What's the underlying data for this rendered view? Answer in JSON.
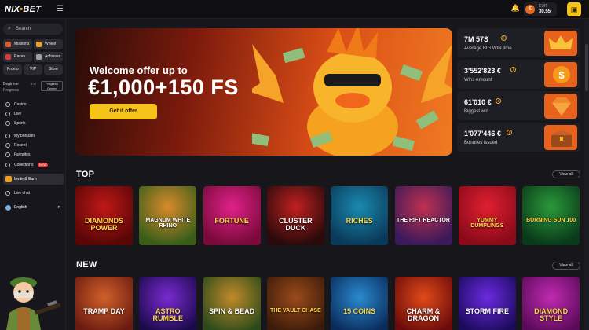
{
  "brand": {
    "part1": "NIX",
    "part2": "BET"
  },
  "header": {
    "currency": "EUR",
    "balance": "30.55"
  },
  "sidebar": {
    "search_placeholder": "Search",
    "tiles": [
      {
        "label": "Missions",
        "color": "#e0572a"
      },
      {
        "label": "Wheel",
        "color": "#f0a020"
      },
      {
        "label": "Races",
        "color": "#d93a3a"
      },
      {
        "label": "Achieves",
        "color": "#a0a0a8"
      },
      {
        "label": "Promo",
        "color": "#555"
      },
      {
        "label": "VIP",
        "color": "#555"
      },
      {
        "label": "Store",
        "color": "#555"
      }
    ],
    "progress": {
      "level": "Beginner",
      "percent": "1 of",
      "progress_label": "Progress",
      "center": "Progress Center"
    },
    "nav": [
      {
        "label": "Casino"
      },
      {
        "label": "Live"
      },
      {
        "label": "Sports"
      },
      {
        "label": "My bonuses"
      },
      {
        "label": "Recent"
      },
      {
        "label": "Favorites"
      },
      {
        "label": "Collections",
        "badge": "NEW"
      }
    ],
    "invite": "Invite & Earn",
    "live_chat": "Live chat",
    "language": "English"
  },
  "banner": {
    "line1": "Welcome offer up to",
    "line2": "€1,000+150 FS",
    "button": "Get it offer"
  },
  "stats": [
    {
      "value": "7M 57S",
      "label": "Average BIG WIN time"
    },
    {
      "value": "3'552'823 €",
      "label": "Wins Amount"
    },
    {
      "value": "61'010 €",
      "label": "Biggest win"
    },
    {
      "value": "1'077'446 €",
      "label": "Bonuses issued"
    }
  ],
  "sections": {
    "top": {
      "title": "TOP",
      "view_all": "View all",
      "games": [
        {
          "name": "DIAMONDS POWER",
          "bg1": "#5a0606",
          "bg2": "#c01818",
          "fg": "#ffd54a"
        },
        {
          "name": "MAGNUM WHITE RHINO",
          "bg1": "#3a5e1a",
          "bg2": "#d98a2a",
          "fg": "#fff"
        },
        {
          "name": "FORTUNE",
          "bg1": "#7a0a3a",
          "bg2": "#e0218a",
          "fg": "#ffd54a"
        },
        {
          "name": "CLUSTER DUCK",
          "bg1": "#2a0a0a",
          "bg2": "#c02020",
          "fg": "#fff"
        },
        {
          "name": "RICHES",
          "bg1": "#0a3a5a",
          "bg2": "#1a8ab0",
          "fg": "#ffd54a"
        },
        {
          "name": "THE RIFT REACTOR",
          "bg1": "#3a1a5a",
          "bg2": "#c03050",
          "fg": "#fff"
        },
        {
          "name": "YUMMY DUMPLINGS",
          "bg1": "#8a0a1a",
          "bg2": "#e02030",
          "fg": "#ffd54a"
        },
        {
          "name": "BURNING SUN 100",
          "bg1": "#0a3a1a",
          "bg2": "#2a9a3a",
          "fg": "#ffd54a"
        }
      ]
    },
    "new": {
      "title": "NEW",
      "view_all": "View all",
      "games": [
        {
          "name": "TRAMP DAY",
          "bg1": "#6a1a10",
          "bg2": "#d0602a",
          "fg": "#fff"
        },
        {
          "name": "ASTRO RUMBLE",
          "bg1": "#1a0a4a",
          "bg2": "#7a2ad0",
          "fg": "#ffd54a"
        },
        {
          "name": "SPIN & BEAD",
          "bg1": "#2a4a1a",
          "bg2": "#c08a2a",
          "fg": "#fff"
        },
        {
          "name": "THE VAULT CHASE",
          "bg1": "#3a1a0a",
          "bg2": "#9a4a1a",
          "fg": "#ffd54a"
        },
        {
          "name": "15 COINS",
          "bg1": "#0a2a5a",
          "bg2": "#2a8ad0",
          "fg": "#ffd54a"
        },
        {
          "name": "CHARM & DRAGON",
          "bg1": "#6a0a0a",
          "bg2": "#e04a1a",
          "fg": "#fff"
        },
        {
          "name": "STORM FIRE",
          "bg1": "#1a0a5a",
          "bg2": "#6a2ae0",
          "fg": "#fff"
        },
        {
          "name": "DIAMOND STYLE",
          "bg1": "#5a0a5a",
          "bg2": "#c02ab0",
          "fg": "#ffd54a"
        }
      ]
    }
  }
}
